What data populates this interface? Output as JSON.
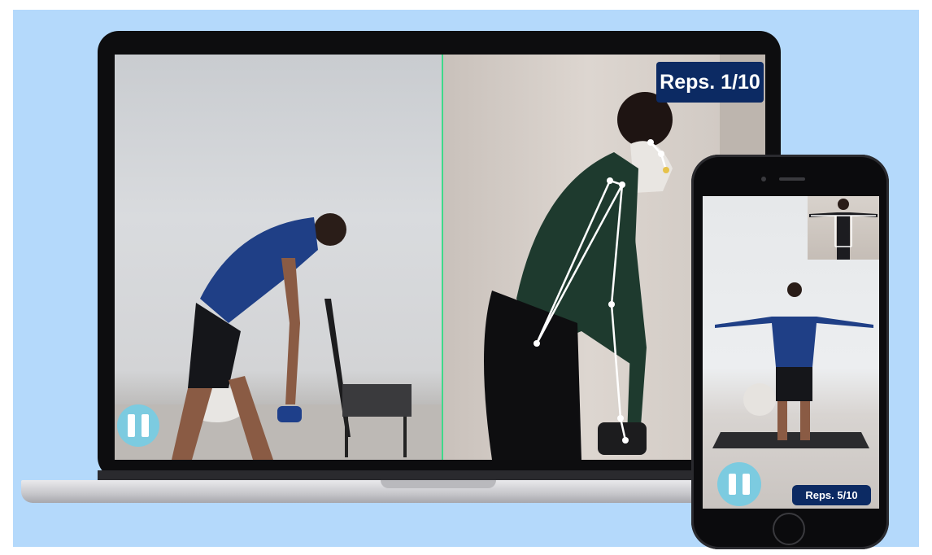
{
  "laptop": {
    "reps_label": "Reps. 1/10",
    "split_line_color": "#3fd98a"
  },
  "phone": {
    "reps_label": "Reps. 5/10"
  },
  "colors": {
    "background": "#b4d9fb",
    "reps_badge": "#0c2a63",
    "pause_button": "#7ccbe0"
  },
  "icons": {
    "pause": "pause-icon"
  }
}
